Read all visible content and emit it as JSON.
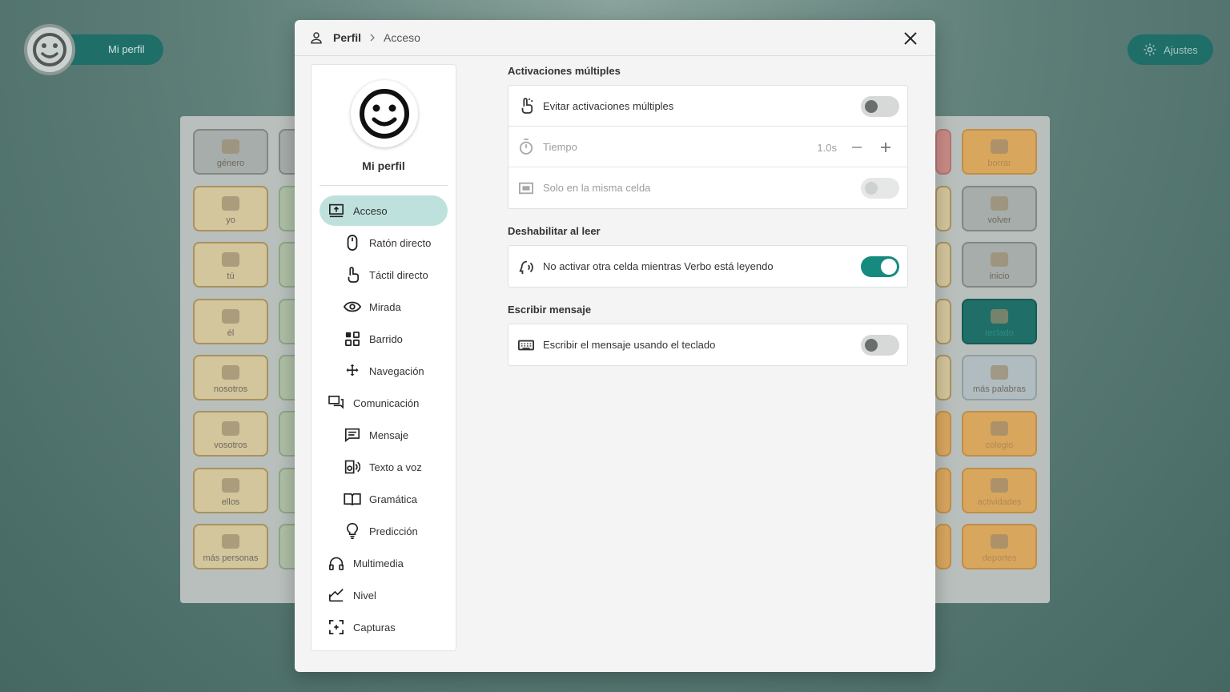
{
  "background": {
    "profile_label": "Mi perfil",
    "settings_label": "Ajustes",
    "left_cells": [
      "género",
      "yo",
      "tú",
      "él",
      "nosotros",
      "vosotros",
      "ellos",
      "más personas"
    ],
    "right_cells": [
      "borrar",
      "volver",
      "inicio",
      "teclado",
      "más palabras",
      "colegio",
      "actividades",
      "deportes"
    ]
  },
  "header": {
    "title": "Perfil",
    "current": "Acceso"
  },
  "profile": {
    "name": "Mi perfil"
  },
  "menu": [
    {
      "label": "Acceso",
      "icon": "monitor-upload-icon",
      "level": "top",
      "active": true
    },
    {
      "label": "Ratón directo",
      "icon": "mouse-icon",
      "level": "sub"
    },
    {
      "label": "Táctil directo",
      "icon": "touch-icon",
      "level": "sub"
    },
    {
      "label": "Mirada",
      "icon": "eye-icon",
      "level": "sub"
    },
    {
      "label": "Barrido",
      "icon": "grid-icon",
      "level": "sub"
    },
    {
      "label": "Navegación",
      "icon": "move-arrows-icon",
      "level": "sub"
    },
    {
      "label": "Comunicación",
      "icon": "chat-icon",
      "level": "top"
    },
    {
      "label": "Mensaje",
      "icon": "message-icon",
      "level": "sub"
    },
    {
      "label": "Texto a voz",
      "icon": "speaker-icon",
      "level": "sub"
    },
    {
      "label": "Gramática",
      "icon": "book-icon",
      "level": "sub"
    },
    {
      "label": "Predicción",
      "icon": "lightbulb-icon",
      "level": "sub"
    },
    {
      "label": "Multimedia",
      "icon": "headphones-icon",
      "level": "top"
    },
    {
      "label": "Nivel",
      "icon": "chart-level-icon",
      "level": "top"
    },
    {
      "label": "Capturas",
      "icon": "capture-icon",
      "level": "top"
    }
  ],
  "sections": {
    "multi": {
      "title": "Activaciones múltiples",
      "avoid_label": "Evitar activaciones múltiples",
      "time_label": "Tiempo",
      "time_value": "1.0s",
      "same_cell_label": "Solo en la misma celda"
    },
    "reading": {
      "title": "Deshabilitar al leer",
      "no_activate_label": "No activar otra celda mientras Verbo está leyendo"
    },
    "write": {
      "title": "Escribir mensaje",
      "keyboard_label": "Escribir el mensaje usando el teclado"
    }
  },
  "toggles": {
    "avoid_multiple": false,
    "same_cell": false,
    "no_activate_while_reading": true,
    "write_with_keyboard": false
  },
  "colors": {
    "accent": "#178a7f",
    "active_menu": "#bfe1dd"
  }
}
